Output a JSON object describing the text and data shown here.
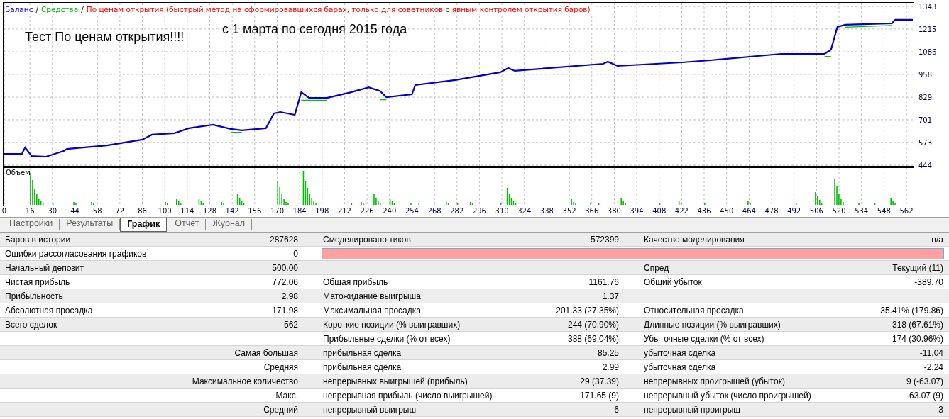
{
  "chart": {
    "legend": [
      {
        "kind": "series"
      },
      {
        "kind": "text",
        "text": "/"
      },
      {
        "kind": "series"
      },
      {
        "kind": "text",
        "text": "/"
      },
      {
        "kind": "text",
        "text": "По ценам открытия (быстрый метод на сформировавшихся барах, только для советников с явным контролем открытия баров)",
        "color": "#ff0000"
      }
    ],
    "notes": [
      "Тест По ценам открытия!!!!",
      "с 1 марта по сегодня 2015 года"
    ],
    "volume_label": "Объем",
    "chart_data": {
      "type": "line",
      "xlim": [
        0,
        567
      ],
      "ylim": [
        444,
        1343
      ],
      "x": [
        0,
        11,
        13,
        17,
        26,
        37,
        39,
        64,
        86,
        92,
        106,
        115,
        130,
        141,
        148,
        163,
        168,
        172,
        181,
        185,
        190,
        201,
        216,
        227,
        234,
        238,
        254,
        256,
        281,
        309,
        314,
        318,
        373,
        376,
        382,
        422,
        440,
        484,
        511,
        515,
        519,
        524,
        553,
        555,
        566
      ],
      "series": [
        {
          "name": "Средства",
          "color": "#00c000",
          "values": [
            null,
            null,
            null,
            null,
            null,
            null,
            null,
            null,
            null,
            null,
            null,
            null,
            null,
            630,
            630,
            null,
            null,
            null,
            null,
            812,
            812,
            812,
            null,
            null,
            815,
            815,
            null,
            null,
            null,
            null,
            null,
            null,
            null,
            null,
            null,
            null,
            null,
            null,
            1060,
            1060,
            null,
            1225,
            1235,
            null,
            null
          ]
        },
        {
          "name": "Баланс",
          "color": "#0000c8",
          "values": [
            508,
            508,
            544,
            496,
            492,
            524,
            536,
            556,
            589,
            617,
            625,
            653,
            673,
            649,
            641,
            653,
            737,
            745,
            729,
            857,
            825,
            825,
            857,
            885,
            865,
            829,
            845,
            898,
            926,
            970,
            994,
            978,
            1018,
            1030,
            1006,
            1026,
            1038,
            1074,
            1074,
            1098,
            1227,
            1239,
            1247,
            1267,
            1267
          ]
        }
      ],
      "xticks": [
        0,
        16,
        30,
        44,
        58,
        72,
        86,
        100,
        114,
        128,
        142,
        156,
        170,
        184,
        198,
        212,
        226,
        240,
        254,
        268,
        282,
        296,
        310,
        324,
        338,
        352,
        366,
        380,
        394,
        408,
        422,
        436,
        450,
        464,
        478,
        492,
        506,
        520,
        534,
        548,
        562
      ],
      "yticks": [
        444,
        573,
        701,
        829,
        958,
        1086,
        1215,
        1343
      ],
      "grid": true
    }
  },
  "tabs": [
    {
      "label": "Настройки",
      "selected": false
    },
    {
      "label": "Результаты",
      "selected": false
    },
    {
      "label": "График",
      "selected": true
    },
    {
      "label": "Отчет",
      "selected": false
    },
    {
      "label": "Журнал",
      "selected": false
    }
  ],
  "report": {
    "rows": [
      {
        "kind": "main",
        "cells": [
          "Баров в истории",
          "287628",
          "Смоделировано тиков",
          "572399",
          "Качество моделирования",
          "n/a"
        ]
      },
      {
        "kind": "bar",
        "cells": [
          "Ошибки рассогласования графиков",
          "0"
        ]
      },
      {
        "kind": "main",
        "cells": [
          "Начальный депозит",
          "500.00",
          null,
          null,
          "Спред",
          "Текущий (11)"
        ]
      },
      {
        "kind": "main",
        "cells": [
          "Чистая прибыль",
          "772.06",
          "Общая прибыль",
          "1161.76",
          "Общий убыток",
          "-389.70"
        ]
      },
      {
        "kind": "main",
        "cells": [
          "Прибыльность",
          "2.98",
          "Матожидание выигрыша",
          "1.37",
          null,
          null
        ]
      },
      {
        "kind": "main",
        "cells": [
          "Абсолютная просадка",
          "171.98",
          "Максимальная просадка",
          "201.33 (27.35%)",
          "Относительная просадка",
          "35.41% (179.86)"
        ]
      },
      {
        "kind": "main",
        "cells": [
          "Всего сделок",
          "562",
          "Короткие позиции (% выигравших)",
          "244 (70.90%)",
          "Длинные позиции (% выигравших)",
          "318 (67.61%)"
        ]
      },
      {
        "kind": "main",
        "cells": [
          null,
          null,
          "Прибыльные сделки (% от всех)",
          "388 (69.04%)",
          "Убыточные сделки (% от всех)",
          "174 (30.96%)"
        ]
      },
      {
        "kind": "detail",
        "cells": [
          "Самая большая",
          "прибыльная сделка",
          "85.25",
          "убыточная сделка",
          "-11.04"
        ]
      },
      {
        "kind": "detail",
        "cells": [
          "Средняя",
          "прибыльная сделка",
          "2.99",
          "убыточная сделка",
          "-2.24"
        ]
      },
      {
        "kind": "detail",
        "cells": [
          "Максимальное количество",
          "непрерывных выигрышей (прибыль)",
          "29 (37.39)",
          "непрерывных проигрышей (убыток)",
          "9 (-63.07)"
        ]
      },
      {
        "kind": "detail",
        "cells": [
          "Макс.",
          "непрерывная прибыль (число выигрышей)",
          "171.65 (9)",
          "непрерывный убыток (число проигрышей)",
          "-63.07 (9)"
        ]
      },
      {
        "kind": "detail",
        "cells": [
          "Средний",
          "непрерывный выигрыш",
          "6",
          "непрерывный проигрыш",
          "3"
        ]
      }
    ]
  }
}
